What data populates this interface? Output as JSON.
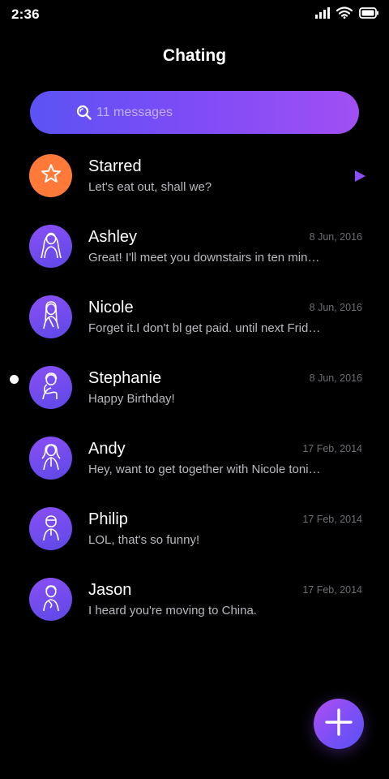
{
  "status_bar": {
    "time": "2:36"
  },
  "header": {
    "title": "Chating"
  },
  "search": {
    "placeholder": "11 messages"
  },
  "chats": [
    {
      "name": "Starred",
      "preview": "Let's eat out, shall we?",
      "date": "",
      "avatar_icon": "star-icon",
      "action_icon": "send-icon"
    },
    {
      "name": "Ashley",
      "preview": "Great! I'll meet you downstairs in ten minutes.",
      "date": "8 Jun, 2016",
      "avatar_icon": "user-icon"
    },
    {
      "name": "Nicole",
      "preview": "Forget it.I don't bl get paid. until next Friday.",
      "date": "8 Jun, 2016",
      "avatar_icon": "user-icon"
    },
    {
      "name": "Stephanie",
      "preview": "Happy Birthday!",
      "date": "8 Jun, 2016",
      "avatar_icon": "user-icon",
      "unread": true
    },
    {
      "name": "Andy",
      "preview": "Hey, want to get together with Nicole tonight?",
      "date": "17 Feb, 2014",
      "avatar_icon": "user-icon"
    },
    {
      "name": "Philip",
      "preview": "LOL, that's so funny!",
      "date": "17 Feb, 2014",
      "avatar_icon": "user-icon"
    },
    {
      "name": "Jason",
      "preview": "I heard you're moving to China.",
      "date": "17 Feb, 2014",
      "avatar_icon": "user-icon"
    }
  ],
  "fab": {
    "icon": "plus-icon"
  },
  "colors": {
    "accent_start": "#5c53f4",
    "accent_end": "#a14ff4",
    "starred": "#ff7a39",
    "background": "#000000"
  }
}
